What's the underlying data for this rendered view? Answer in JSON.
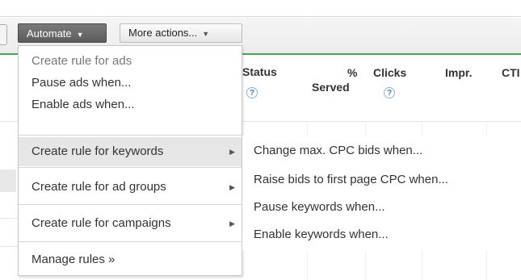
{
  "toolbar": {
    "automate_label": "Automate",
    "more_actions_label": "More actions..."
  },
  "columns": {
    "status": "Status",
    "percent_served_line1": "%",
    "percent_served_line2": "Served",
    "clicks": "Clicks",
    "impr": "Impr.",
    "ctr": "CTI",
    "help_glyph": "?"
  },
  "automate_menu": {
    "create_rule_ads": "Create rule for ads",
    "pause_ads": "Pause ads when...",
    "enable_ads": "Enable ads when...",
    "create_rule_keywords": "Create rule for keywords",
    "create_rule_ad_groups": "Create rule for ad groups",
    "create_rule_campaigns": "Create rule for campaigns",
    "manage_rules": "Manage rules »"
  },
  "keywords_submenu": {
    "change_max_cpc": "Change max. CPC bids when...",
    "raise_bids": "Raise bids to first page CPC when...",
    "pause_keywords": "Pause keywords when...",
    "enable_keywords": "Enable keywords when..."
  },
  "icons": {
    "caret": "dropdown-caret-icon",
    "submenu_arrow": "submenu-arrow-icon",
    "help": "help-icon"
  },
  "colors": {
    "toolbar_accent": "#4aa35b",
    "automate_button": "#666666",
    "help_icon": "#3d7fbf"
  }
}
